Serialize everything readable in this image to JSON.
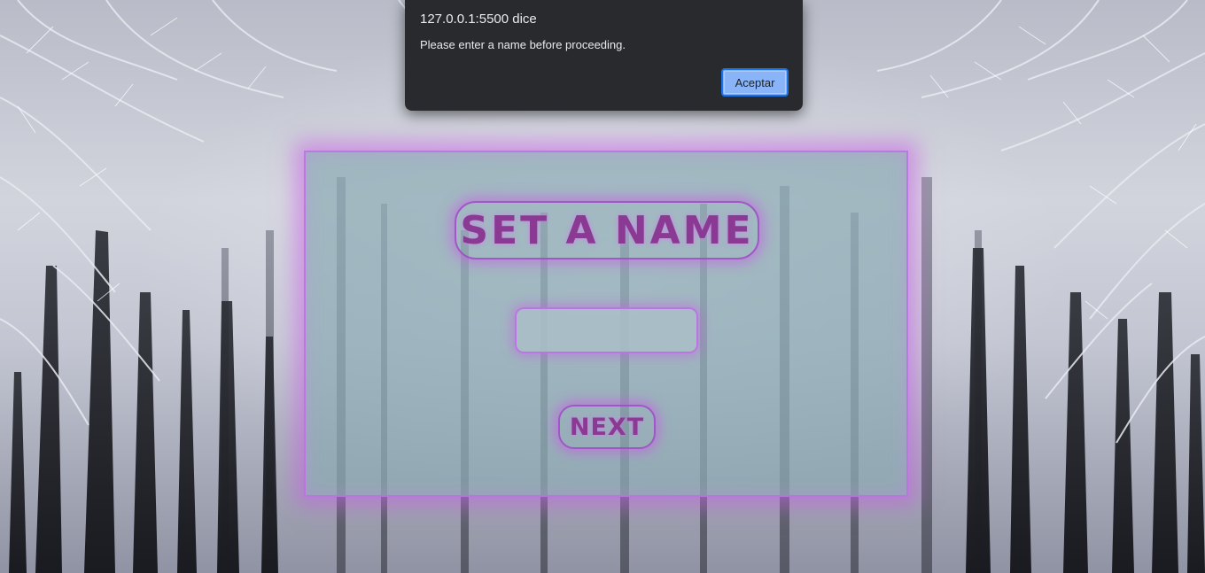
{
  "alert": {
    "origin": "127.0.0.1:5500 dice",
    "message": "Please enter a name before proceeding.",
    "ok_label": "Aceptar"
  },
  "card": {
    "title": "SET A NAME",
    "name_input_value": "",
    "next_label": "NEXT"
  },
  "colors": {
    "accent": "#8a3a92",
    "glow": "#c85ae6",
    "card_fill": "#8caab4",
    "dialog_bg": "#292a2d",
    "dialog_button": "#8ab4f8"
  }
}
